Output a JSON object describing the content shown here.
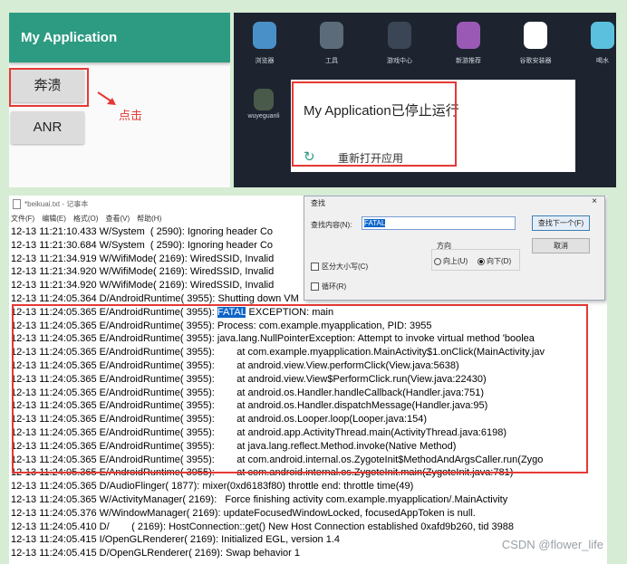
{
  "app": {
    "title": "My Application",
    "crash_button": "奔溃",
    "anr_button": "ANR",
    "click_hint": "点击"
  },
  "launcher": {
    "icons": [
      {
        "label": "浏览器",
        "color": "#4a90c8"
      },
      {
        "label": "工具",
        "color": "#5b6b7a"
      },
      {
        "label": "游戏中心",
        "color": "#3a4656"
      },
      {
        "label": "新游推荐",
        "color": "#9b59b6"
      },
      {
        "label": "谷歌安装器",
        "color": "#ffffff"
      },
      {
        "label": "喝水",
        "color": "#5bc0de"
      }
    ],
    "extra_icon_label": "wuyeguanli",
    "dialog_title": "My Application已停止运行",
    "restart_label": "重新打开应用"
  },
  "notepad": {
    "title": "*beikuai.txt - 记事本",
    "menu": [
      "文件(F)",
      "编辑(E)",
      "格式(O)",
      "查看(V)",
      "帮助(H)"
    ],
    "log_lines": [
      "12-13 11:21:10.433 W/System  ( 2590): Ignoring header Co",
      "12-13 11:21:30.684 W/System  ( 2590): Ignoring header Co",
      "12-13 11:21:34.919 W/WifiMode( 2169): WiredSSID, Invalid",
      "12-13 11:21:34.920 W/WifiMode( 2169): WiredSSID, Invalid",
      "12-13 11:21:34.920 W/WifiMode( 2169): WiredSSID, Invalid",
      "12-13 11:24:05.364 D/AndroidRuntime( 3955): Shutting down VM",
      "12-13 11:24:05.365 E/AndroidRuntime( 3955): |FATAL| EXCEPTION: main",
      "12-13 11:24:05.365 E/AndroidRuntime( 3955): Process: com.example.myapplication, PID: 3955",
      "12-13 11:24:05.365 E/AndroidRuntime( 3955): java.lang.NullPointerException: Attempt to invoke virtual method 'boolea",
      "12-13 11:24:05.365 E/AndroidRuntime( 3955):        at com.example.myapplication.MainActivity$1.onClick(MainActivity.jav",
      "12-13 11:24:05.365 E/AndroidRuntime( 3955):        at android.view.View.performClick(View.java:5638)",
      "12-13 11:24:05.365 E/AndroidRuntime( 3955):        at android.view.View$PerformClick.run(View.java:22430)",
      "12-13 11:24:05.365 E/AndroidRuntime( 3955):        at android.os.Handler.handleCallback(Handler.java:751)",
      "12-13 11:24:05.365 E/AndroidRuntime( 3955):        at android.os.Handler.dispatchMessage(Handler.java:95)",
      "12-13 11:24:05.365 E/AndroidRuntime( 3955):        at android.os.Looper.loop(Looper.java:154)",
      "12-13 11:24:05.365 E/AndroidRuntime( 3955):        at android.app.ActivityThread.main(ActivityThread.java:6198)",
      "12-13 11:24:05.365 E/AndroidRuntime( 3955):        at java.lang.reflect.Method.invoke(Native Method)",
      "12-13 11:24:05.365 E/AndroidRuntime( 3955):        at com.android.internal.os.ZygoteInit$MethodAndArgsCaller.run(Zygo",
      "12-13 11:24:05.365 E/AndroidRuntime( 3955):        at com.android.internal.os.ZygoteInit.main(ZygoteInit.java:781)",
      "12-13 11:24:05.365 D/AudioFlinger( 1877): mixer(0xd6183f80) throttle end: throttle time(49)",
      "12-13 11:24:05.365 W/ActivityManager( 2169):   Force finishing activity com.example.myapplication/.MainActivity",
      "12-13 11:24:05.376 W/WindowManager( 2169): updateFocusedWindowLocked, focusedAppToken is null.",
      "12-13 11:24:05.410 D/        ( 2169): HostConnection::get() New Host Connection established 0xafd9b260, tid 3988",
      "12-13 11:24:05.415 I/OpenGLRenderer( 2169): Initialized EGL, version 1.4",
      "12-13 11:24:05.415 D/OpenGLRenderer( 2169): Swap behavior 1"
    ],
    "highlight_term": "FATAL",
    "watermark": "CSDN @flower_life"
  },
  "find_dialog": {
    "title": "查找",
    "close": "×",
    "find_what_label": "查找内容(N):",
    "find_what_value": "FATAL",
    "find_next_button": "查找下一个(F)",
    "cancel_button": "取消",
    "direction_label": "方向",
    "up_label": "向上(U)",
    "down_label": "向下(D)",
    "direction_selected": "down",
    "match_case_label": "区分大小写(C)",
    "wrap_label": "循环(R)"
  }
}
